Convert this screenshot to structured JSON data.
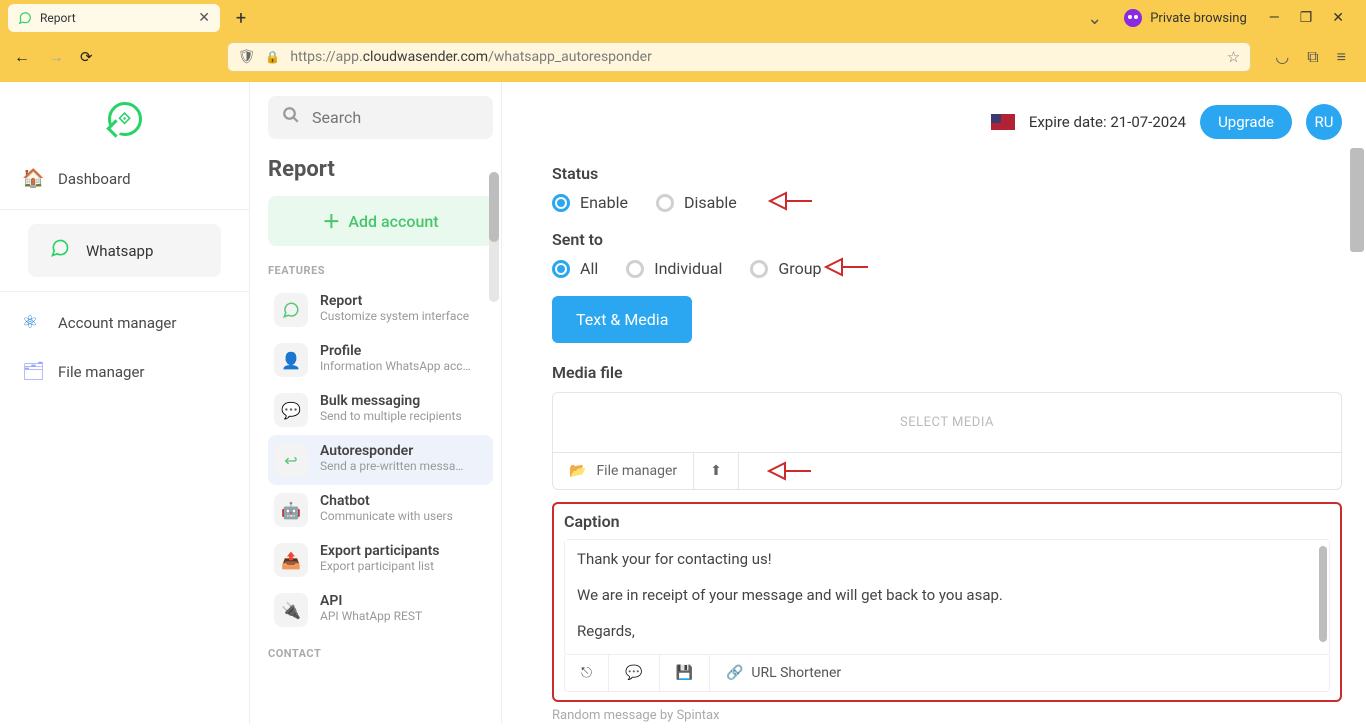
{
  "browser": {
    "tab_title": "Report",
    "private_browsing": "Private browsing",
    "url_prefix": "https://app.",
    "url_domain": "cloudwasender.com",
    "url_path": "/whatsapp_autoresponder"
  },
  "sidebar": {
    "dashboard": "Dashboard",
    "whatsapp": "Whatsapp",
    "account_manager": "Account manager",
    "file_manager": "File manager"
  },
  "panel": {
    "search_placeholder": "Search",
    "title": "Report",
    "add_account": "Add account",
    "features_label": "FEATURES",
    "contact_label": "CONTACT",
    "features": [
      {
        "title": "Report",
        "sub": "Customize system interface"
      },
      {
        "title": "Profile",
        "sub": "Information WhatsApp acc…"
      },
      {
        "title": "Bulk messaging",
        "sub": "Send to multiple recipients"
      },
      {
        "title": "Autoresponder",
        "sub": "Send a pre-written messa…"
      },
      {
        "title": "Chatbot",
        "sub": "Communicate with users"
      },
      {
        "title": "Export participants",
        "sub": "Export participant list"
      },
      {
        "title": "API",
        "sub": "API WhatApp REST"
      }
    ]
  },
  "topbar": {
    "expire": "Expire date: 21-07-2024",
    "upgrade": "Upgrade",
    "avatar": "RU"
  },
  "form": {
    "status_label": "Status",
    "status_enable": "Enable",
    "status_disable": "Disable",
    "sentto_label": "Sent to",
    "sentto_all": "All",
    "sentto_individual": "Individual",
    "sentto_group": "Group",
    "text_media": "Text & Media",
    "mediafile_label": "Media file",
    "select_media": "SELECT MEDIA",
    "file_manager": "File manager",
    "caption_label": "Caption",
    "caption_value": "Thank your for contacting us!\n\nWe are in receipt of your message and will get back to you asap.\n\nRegards,",
    "url_shortener": "URL Shortener",
    "spintax_note": "Random message by Spintax"
  }
}
